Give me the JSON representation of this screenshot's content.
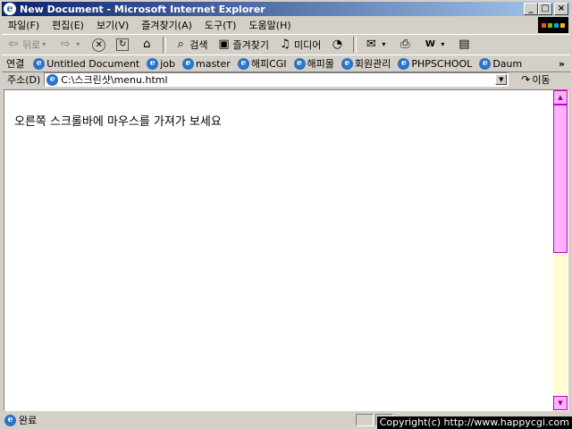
{
  "window": {
    "title": "New Document - Microsoft Internet Explorer"
  },
  "menu": [
    "파일(F)",
    "편집(E)",
    "보기(V)",
    "즐겨찾기(A)",
    "도구(T)",
    "도움말(H)"
  ],
  "toolbar": {
    "back": "뒤로",
    "search": "검색",
    "favorites": "즐겨찾기",
    "media": "미디어"
  },
  "links": {
    "label": "연결",
    "items": [
      "Untitled Document",
      "job",
      "master",
      "해피CGI",
      "해피몰",
      "회원관리",
      "PHPSCHOOL",
      "Daum"
    ],
    "more": "»"
  },
  "address": {
    "label": "주소(D)",
    "value": "C:\\스크린샷\\menu.html",
    "go": "이동"
  },
  "page": {
    "message": "오른쪽 스크롤바에 마우스를 가져가 보세요"
  },
  "status": {
    "text": "완료",
    "copyright": "Copyright(c) http://www.happycgi.com"
  },
  "scrollbar": {
    "position_fraction": 0.0
  },
  "colors": {
    "scroll_face": "#ffb0ff",
    "scroll_track": "#fffdd0",
    "title_start": "#0a246a"
  }
}
